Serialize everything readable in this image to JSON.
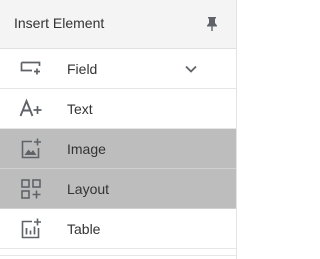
{
  "header": {
    "title": "Insert Element",
    "pin_icon": "pin-icon"
  },
  "items": [
    {
      "label": "Field",
      "icon": "field-icon",
      "has_dropdown": true,
      "active": false
    },
    {
      "label": "Text",
      "icon": "text-icon",
      "has_dropdown": false,
      "active": false
    },
    {
      "label": "Image",
      "icon": "add-image-icon",
      "has_dropdown": false,
      "active": true
    },
    {
      "label": "Layout",
      "icon": "layout-icon",
      "has_dropdown": false,
      "active": true
    },
    {
      "label": "Table",
      "icon": "add-chart-table-icon",
      "has_dropdown": false,
      "active": false
    }
  ],
  "colors": {
    "header_bg": "#f4f4f4",
    "active_bg": "#bdbdbd",
    "icon": "#5f6368",
    "text": "#333333"
  }
}
